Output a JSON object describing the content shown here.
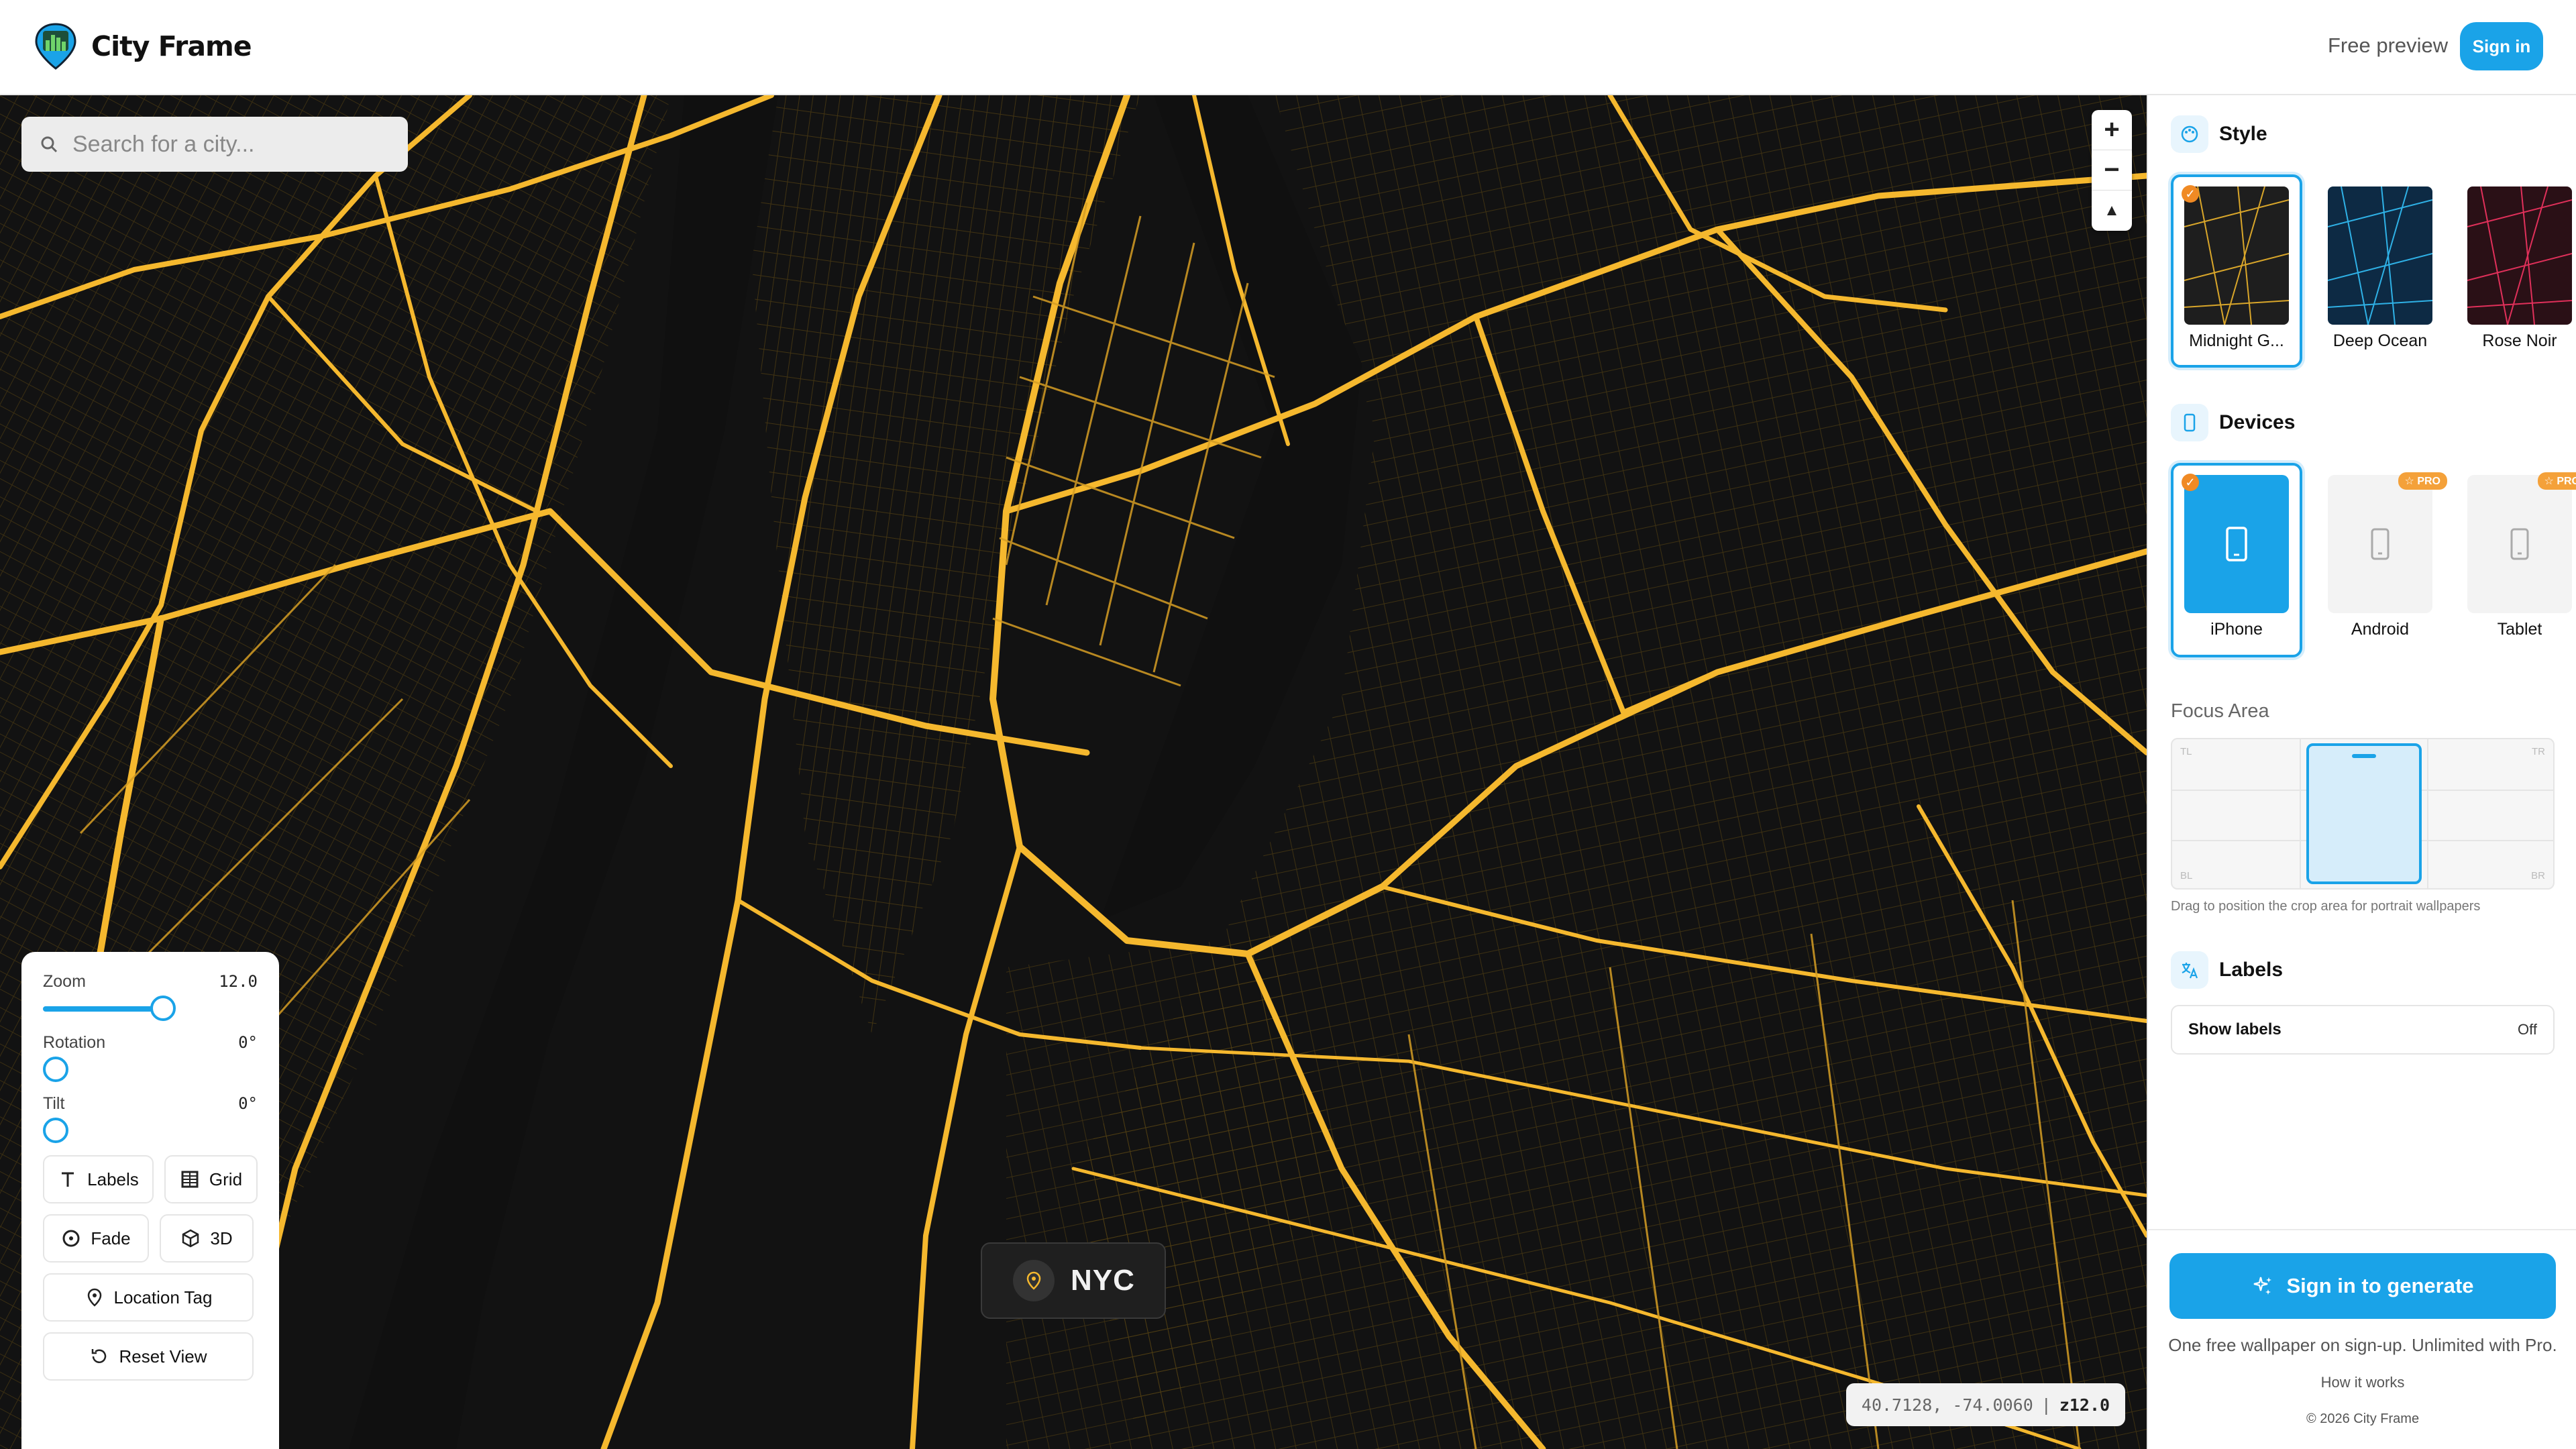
{
  "header": {
    "brand": "City Frame",
    "free_preview": "Free preview",
    "sign_in": "Sign in"
  },
  "map": {
    "search_placeholder": "Search for a city...",
    "city_chip": "NYC",
    "coords": "40.7128, -74.0060",
    "zoom_badge": "z12.0",
    "zoom_in": "+",
    "zoom_out": "−",
    "compass": "▲",
    "road_color": "#f5b82e",
    "background_color": "#121212"
  },
  "controls": {
    "zoom_label": "Zoom",
    "zoom_value": "12.0",
    "rotation_label": "Rotation",
    "rotation_value": "0°",
    "tilt_label": "Tilt",
    "tilt_value": "0°",
    "labels_btn": "Labels",
    "grid_btn": "Grid",
    "fade_btn": "Fade",
    "three_d_btn": "3D",
    "location_tag_btn": "Location Tag",
    "reset_view_btn": "Reset View"
  },
  "sidebar": {
    "style_title": "Style",
    "styles": [
      {
        "label": "Midnight G...",
        "selected": true,
        "bg": "#1e1e1e",
        "road": "#d9a62a"
      },
      {
        "label": "Deep Ocean",
        "selected": false,
        "bg": "#0d2a44",
        "road": "#2fb1e6"
      },
      {
        "label": "Rose Noir",
        "selected": false,
        "bg": "#2a1016",
        "road": "#e0305a"
      }
    ],
    "devices_title": "Devices",
    "devices": [
      {
        "label": "iPhone",
        "selected": true,
        "pro": ""
      },
      {
        "label": "Android",
        "selected": false,
        "pro": "☆ PRO"
      },
      {
        "label": "Tablet",
        "selected": false,
        "pro": "☆ PRO"
      }
    ],
    "focus_title": "Focus Area",
    "focus_corners": {
      "tl": "TL",
      "tr": "TR",
      "bl": "BL",
      "br": "BR"
    },
    "focus_hint": "Drag to position the crop area for portrait wallpapers",
    "labels_title": "Labels",
    "show_labels": "Show labels",
    "show_labels_state": "Off",
    "generate_btn": "Sign in to generate",
    "foot_note": "One free wallpaper on sign-up. Unlimited with Pro.",
    "how_it_works": "How it works",
    "copyright": "© 2026 City Frame"
  },
  "colors": {
    "accent": "#1aa3e8",
    "pro_badge": "#f4a13a",
    "check": "#f08a24"
  }
}
